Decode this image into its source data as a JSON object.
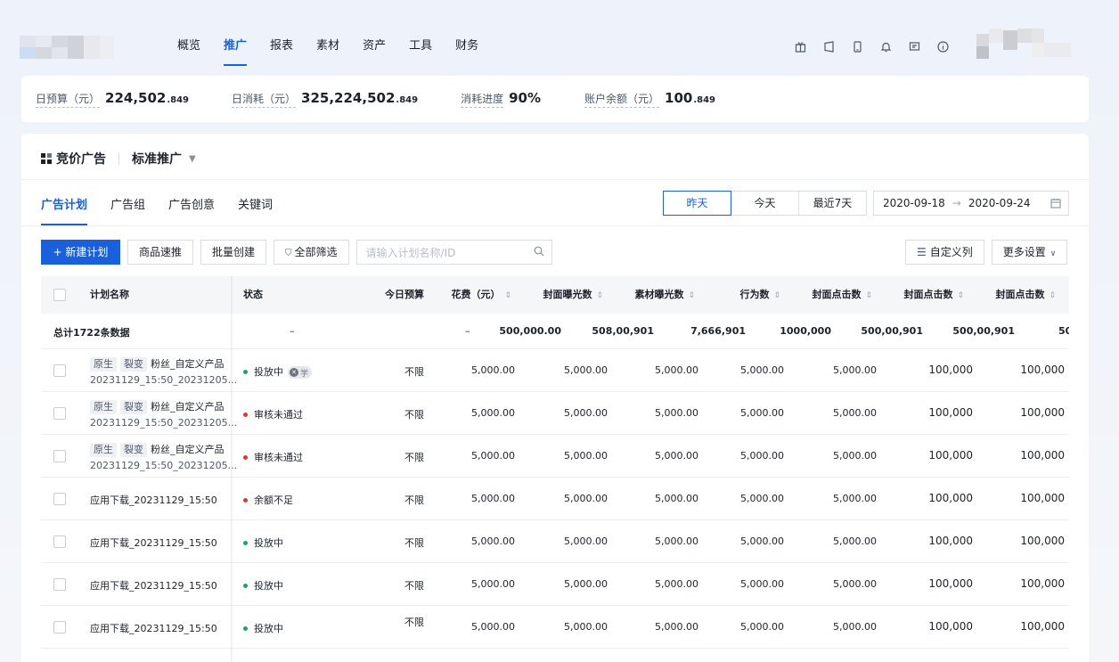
{
  "nav": {
    "items": [
      "概览",
      "推广",
      "报表",
      "素材",
      "资产",
      "工具",
      "财务"
    ],
    "active_index": 1,
    "icons": [
      "gift-icon",
      "tablet-icon",
      "mobile-icon",
      "bell-icon",
      "message-icon",
      "help-icon"
    ]
  },
  "stats": [
    {
      "label": "日预算（元）",
      "value": "224,502",
      "decimal": ".849"
    },
    {
      "label": "日消耗（元）",
      "value": "325,224,502",
      "decimal": ".849"
    },
    {
      "label": "消耗进度",
      "value": "90%",
      "decimal": ""
    },
    {
      "label": "账户余额（元）",
      "value": "100",
      "decimal": ".849"
    }
  ],
  "card": {
    "title": "竞价广告",
    "subtitle": "标准推广"
  },
  "tabs": [
    "广告计划",
    "广告组",
    "广告创意",
    "关键词"
  ],
  "date_filter": {
    "options": [
      "昨天",
      "今天",
      "最近7天"
    ],
    "active_index": 0,
    "start": "2020-09-18",
    "end": "2020-09-24"
  },
  "toolbar": {
    "new_plan": "+ 新建计划",
    "product_quick": "商品速推",
    "batch_create": "批量创建",
    "filter_all": "全部筛选",
    "search_placeholder": "请输入计划名称/ID",
    "custom_columns": "自定义列",
    "more_settings": "更多设置"
  },
  "table": {
    "headers": [
      "计划名称",
      "状态",
      "今日预算",
      "花费（元）",
      "封面曝光数",
      "素材曝光数",
      "行为数",
      "封面点击数",
      "封面点击数",
      "封面点击数"
    ],
    "summary": {
      "label": "总计1722条数据",
      "status": "–",
      "budget": "–",
      "values": [
        "500,000.00",
        "508,00,901",
        "7,666,901",
        "1000,000",
        "500,00,901",
        "500,00,901",
        "50"
      ]
    },
    "rows": [
      {
        "tags": [
          "原生",
          "裂变"
        ],
        "name": "粉丝_自定义产品",
        "name2": "20231129_15:50_20231205...",
        "status": "投放中",
        "status_color": "green",
        "badge": "学",
        "budget": "不限",
        "values": [
          "5,000.00",
          "5,000.00",
          "5,000.00",
          "5,000.00",
          "5,000.00",
          "100,000",
          "100,000"
        ]
      },
      {
        "tags": [
          "原生",
          "裂变"
        ],
        "name": "粉丝_自定义产品",
        "name2": "20231129_15:50_20231205...",
        "status": "审核未通过",
        "status_color": "red",
        "badge": "",
        "budget": "不限",
        "values": [
          "5,000.00",
          "5,000.00",
          "5,000.00",
          "5,000.00",
          "5,000.00",
          "100,000",
          "100,000"
        ]
      },
      {
        "tags": [
          "原生",
          "裂变"
        ],
        "name": "粉丝_自定义产品",
        "name2": "20231129_15:50_20231205...",
        "status": "审核未通过",
        "status_color": "red",
        "badge": "",
        "budget": "不限",
        "values": [
          "5,000.00",
          "5,000.00",
          "5,000.00",
          "5,000.00",
          "5,000.00",
          "100,000",
          "100,000"
        ]
      },
      {
        "tags": [],
        "name": "应用下载_20231129_15:50",
        "name2": "",
        "status": "余额不足",
        "status_color": "red",
        "badge": "",
        "budget": "不限",
        "values": [
          "5,000.00",
          "5,000.00",
          "5,000.00",
          "5,000.00",
          "5,000.00",
          "100,000",
          "100,000"
        ]
      },
      {
        "tags": [],
        "name": "应用下载_20231129_15:50",
        "name2": "",
        "status": "投放中",
        "status_color": "green",
        "badge": "",
        "budget": "不限",
        "values": [
          "5,000.00",
          "5,000.00",
          "5,000.00",
          "5,000.00",
          "5,000.00",
          "100,000",
          "100,000"
        ]
      },
      {
        "tags": [],
        "name": "应用下载_20231129_15:50",
        "name2": "",
        "status": "投放中",
        "status_color": "green",
        "badge": "",
        "budget": "不限",
        "values": [
          "5,000.00",
          "5,000.00",
          "5,000.00",
          "5,000.00",
          "5,000.00",
          "100,000",
          "100,000"
        ]
      },
      {
        "tags": [],
        "name": "应用下载_20231129_15:50",
        "name2": "",
        "status": "投放中",
        "status_color": "green",
        "badge": "",
        "budget": "不限",
        "values": [
          "5,000.00",
          "5,000.00",
          "5,000.00",
          "5,000.00",
          "5,000.00",
          "100,000",
          "100,000"
        ]
      }
    ]
  },
  "colors": {
    "accent": "#1a5fdb",
    "status_green": "#21a362",
    "status_red": "#e0362c"
  }
}
